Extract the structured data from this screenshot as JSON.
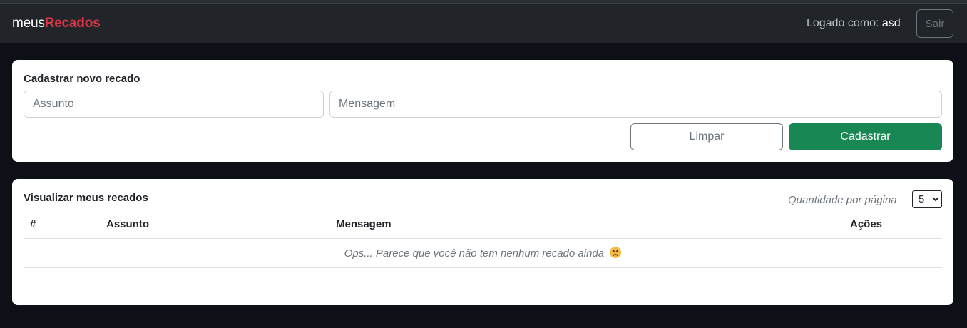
{
  "navbar": {
    "brand_prefix": "meus",
    "brand_accent": "Recados",
    "logged_label": "Logado como: ",
    "username": "asd",
    "logout_label": "Sair"
  },
  "form": {
    "title": "Cadastrar novo recado",
    "subject_placeholder": "Assunto",
    "message_placeholder": "Mensagem",
    "clear_label": "Limpar",
    "submit_label": "Cadastrar"
  },
  "list": {
    "title": "Visualizar meus recados",
    "per_page_label": "Quantidade por página",
    "per_page_value": "5",
    "columns": [
      "#",
      "Assunto",
      "Mensagem",
      "Ações"
    ],
    "empty_message": "Ops... Parece que você não tem nenhum recado ainda",
    "empty_icon": "worried-face-icon"
  },
  "colors": {
    "accent": "#dc3545",
    "primary_button": "#198754",
    "navbar": "#212529",
    "background": "#0d1117"
  }
}
